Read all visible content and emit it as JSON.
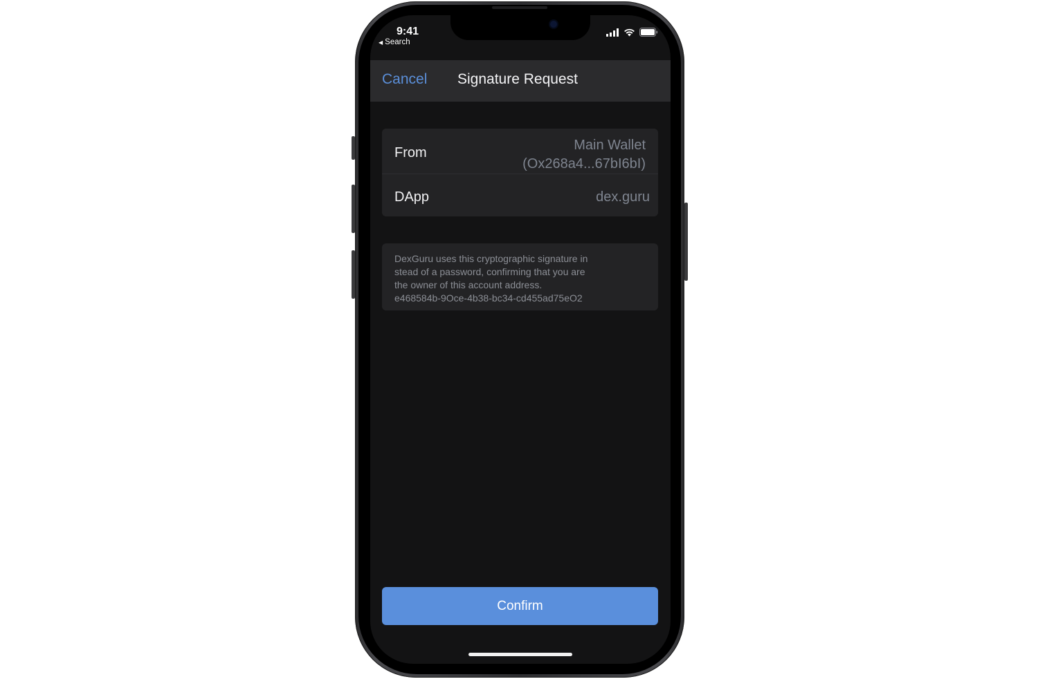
{
  "status_bar": {
    "time": "9:41",
    "back_label": "Search",
    "icons": [
      "cellular-signal-icon",
      "wifi-icon",
      "battery-icon"
    ]
  },
  "header": {
    "cancel_label": "Cancel",
    "title": "Signature Request"
  },
  "details": {
    "from_label": "From",
    "from_wallet_name": "Main Wallet",
    "from_wallet_address": "(Ox268a4...67bI6bI)",
    "dapp_label": "DApp",
    "dapp_value": "dex.guru"
  },
  "message": {
    "line1": "DexGuru uses this cryptographic signature in",
    "line2": "stead of a password, confirming that you are",
    "line3": "the owner of this account address.",
    "line4": "e468584b-9Oce-4b38-bc34-cd455ad75eO2"
  },
  "actions": {
    "confirm_label": "Confirm"
  },
  "colors": {
    "accent": "#5a8fdc",
    "background": "#131314",
    "card": "#232325",
    "header": "#2b2b2d"
  }
}
